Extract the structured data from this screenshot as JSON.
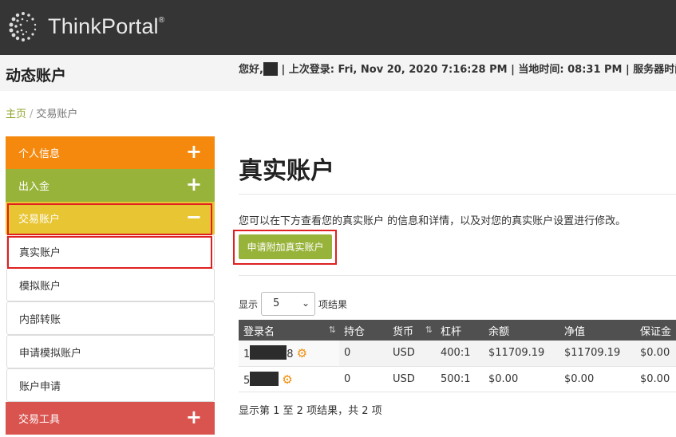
{
  "header": {
    "brand": "ThinkPortal",
    "brand_reg": "®"
  },
  "subheader": {
    "page_heading": "动态账户",
    "greeting": "您好,",
    "last_login_label": "| 上次登录:",
    "last_login_value": "Fri, Nov 20, 2020 7:16:28 PM",
    "local_time_label": "| 当地时间:",
    "local_time_value": "08:31 PM",
    "server_time_label": "| 服务器时间:"
  },
  "breadcrumb": {
    "home": "主页",
    "separator": "/",
    "current": "交易账户"
  },
  "sidebar": {
    "sections": [
      {
        "label": "个人信息",
        "toggle": "+",
        "color": "#f5890e"
      },
      {
        "label": "出入金",
        "toggle": "+",
        "color": "#98b33a"
      },
      {
        "label": "交易账户",
        "toggle": "−",
        "color": "#e8c532"
      },
      {
        "label": "交易工具",
        "toggle": "+",
        "color": "#d9534f"
      }
    ],
    "subitems": [
      "真实账户",
      "模拟账户",
      "内部转账",
      "申请模拟账户",
      "账户申请"
    ]
  },
  "main": {
    "title": "真实账户",
    "description": "您可以在下方查看您的真实账户 的信息和详情，以及对您的真实账户设置进行修改。",
    "apply_button": "申请附加真实账户",
    "show_label": "显示",
    "page_size": "5",
    "results_label": "项结果",
    "footer_info": "显示第 1 至 2 项结果，共 2 项"
  },
  "table": {
    "columns": [
      "登录名",
      "持仓",
      "货币",
      "杠杆",
      "余额",
      "净值",
      "保证金"
    ],
    "rows": [
      {
        "login_prefix": "1",
        "login_suffix": "8",
        "positions": "0",
        "currency": "USD",
        "leverage": "400:1",
        "balance": "$11709.19",
        "equity": "$11709.19",
        "margin": "$0.00"
      },
      {
        "login_prefix": "5",
        "login_suffix": "",
        "positions": "0",
        "currency": "USD",
        "leverage": "500:1",
        "balance": "$0.00",
        "equity": "$0.00",
        "margin": "$0.00"
      }
    ]
  },
  "colors": {
    "accent_green": "#98b33a",
    "header_dark": "#353535",
    "highlight_red": "#e02020",
    "gear_orange": "#f0900e"
  }
}
